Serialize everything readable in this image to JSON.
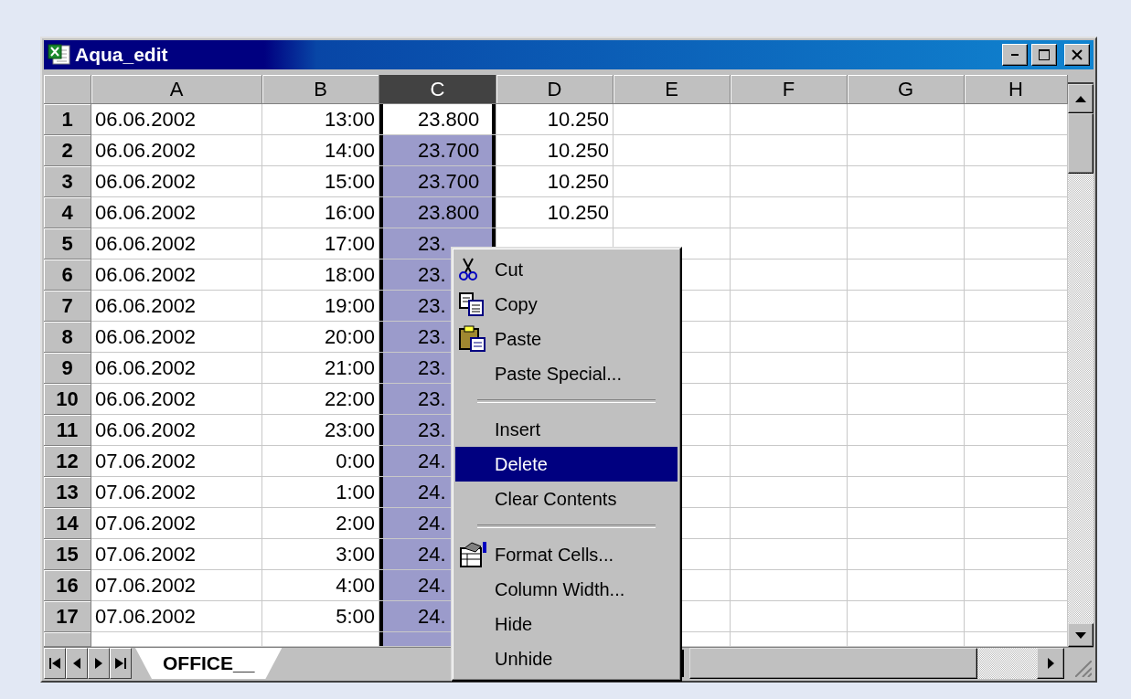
{
  "window": {
    "title": "Aqua_edit"
  },
  "columns": [
    {
      "label": "A",
      "selected": false
    },
    {
      "label": "B",
      "selected": false
    },
    {
      "label": "C",
      "selected": true
    },
    {
      "label": "D",
      "selected": false
    },
    {
      "label": "E",
      "selected": false
    },
    {
      "label": "F",
      "selected": false
    },
    {
      "label": "G",
      "selected": false
    },
    {
      "label": "H",
      "selected": false
    }
  ],
  "rows": [
    {
      "number": "1",
      "active": true,
      "cells": [
        "06.06.2002",
        "13:00",
        "23.800",
        "10.250"
      ]
    },
    {
      "number": "2",
      "active": false,
      "cells": [
        "06.06.2002",
        "14:00",
        "23.700",
        "10.250"
      ]
    },
    {
      "number": "3",
      "active": false,
      "cells": [
        "06.06.2002",
        "15:00",
        "23.700",
        "10.250"
      ]
    },
    {
      "number": "4",
      "active": false,
      "cells": [
        "06.06.2002",
        "16:00",
        "23.800",
        "10.250"
      ]
    },
    {
      "number": "5",
      "active": false,
      "cells": [
        "06.06.2002",
        "17:00",
        "23."
      ]
    },
    {
      "number": "6",
      "active": false,
      "cells": [
        "06.06.2002",
        "18:00",
        "23."
      ]
    },
    {
      "number": "7",
      "active": false,
      "cells": [
        "06.06.2002",
        "19:00",
        "23."
      ]
    },
    {
      "number": "8",
      "active": false,
      "cells": [
        "06.06.2002",
        "20:00",
        "23."
      ]
    },
    {
      "number": "9",
      "active": false,
      "cells": [
        "06.06.2002",
        "21:00",
        "23."
      ]
    },
    {
      "number": "10",
      "active": false,
      "cells": [
        "06.06.2002",
        "22:00",
        "23."
      ]
    },
    {
      "number": "11",
      "active": false,
      "cells": [
        "06.06.2002",
        "23:00",
        "23."
      ]
    },
    {
      "number": "12",
      "active": false,
      "cells": [
        "07.06.2002",
        "0:00",
        "24."
      ]
    },
    {
      "number": "13",
      "active": false,
      "cells": [
        "07.06.2002",
        "1:00",
        "24."
      ]
    },
    {
      "number": "14",
      "active": false,
      "cells": [
        "07.06.2002",
        "2:00",
        "24."
      ]
    },
    {
      "number": "15",
      "active": false,
      "cells": [
        "07.06.2002",
        "3:00",
        "24."
      ]
    },
    {
      "number": "16",
      "active": false,
      "cells": [
        "07.06.2002",
        "4:00",
        "24."
      ]
    },
    {
      "number": "17",
      "active": false,
      "cells": [
        "07.06.2002",
        "5:00",
        "24."
      ]
    }
  ],
  "context_menu": [
    {
      "kind": "cut",
      "label": "Cut",
      "selected": false
    },
    {
      "kind": "copy",
      "label": "Copy",
      "selected": false
    },
    {
      "kind": "paste",
      "label": "Paste",
      "selected": false
    },
    {
      "kind": "plain",
      "label": "Paste Special...",
      "selected": false
    },
    {
      "kind": "separator"
    },
    {
      "kind": "plain",
      "label": "Insert",
      "selected": false
    },
    {
      "kind": "plain",
      "label": "Delete",
      "selected": true
    },
    {
      "kind": "plain",
      "label": "Clear Contents",
      "selected": false
    },
    {
      "kind": "separator"
    },
    {
      "kind": "format",
      "label": "Format Cells...",
      "selected": false
    },
    {
      "kind": "plain",
      "label": "Column Width...",
      "selected": false
    },
    {
      "kind": "plain",
      "label": "Hide",
      "selected": false
    },
    {
      "kind": "plain",
      "label": "Unhide",
      "selected": false
    }
  ],
  "sheet_tabs": [
    {
      "label": "OFFICE__",
      "selected": true
    }
  ]
}
